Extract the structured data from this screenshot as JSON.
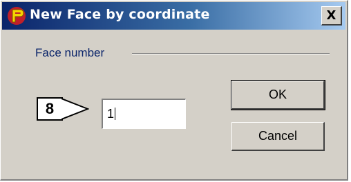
{
  "window": {
    "title": "New Face by coordinate",
    "close_label": "X"
  },
  "group": {
    "label": "Face number"
  },
  "callout": {
    "step_number": "8"
  },
  "face_input": {
    "value": "1"
  },
  "buttons": {
    "ok_label": "OK",
    "cancel_label": "Cancel"
  },
  "colors": {
    "title_gradient_start": "#0a246a",
    "title_gradient_end": "#a6caf0",
    "dialog_face": "#d4d0c8",
    "group_label": "#0a246a",
    "app_icon_red": "#c0202a",
    "app_icon_yellow": "#f5d400"
  },
  "icons": {
    "app": "app-logo-icon",
    "close": "close-icon",
    "callout_arrow": "arrow-right-icon"
  }
}
